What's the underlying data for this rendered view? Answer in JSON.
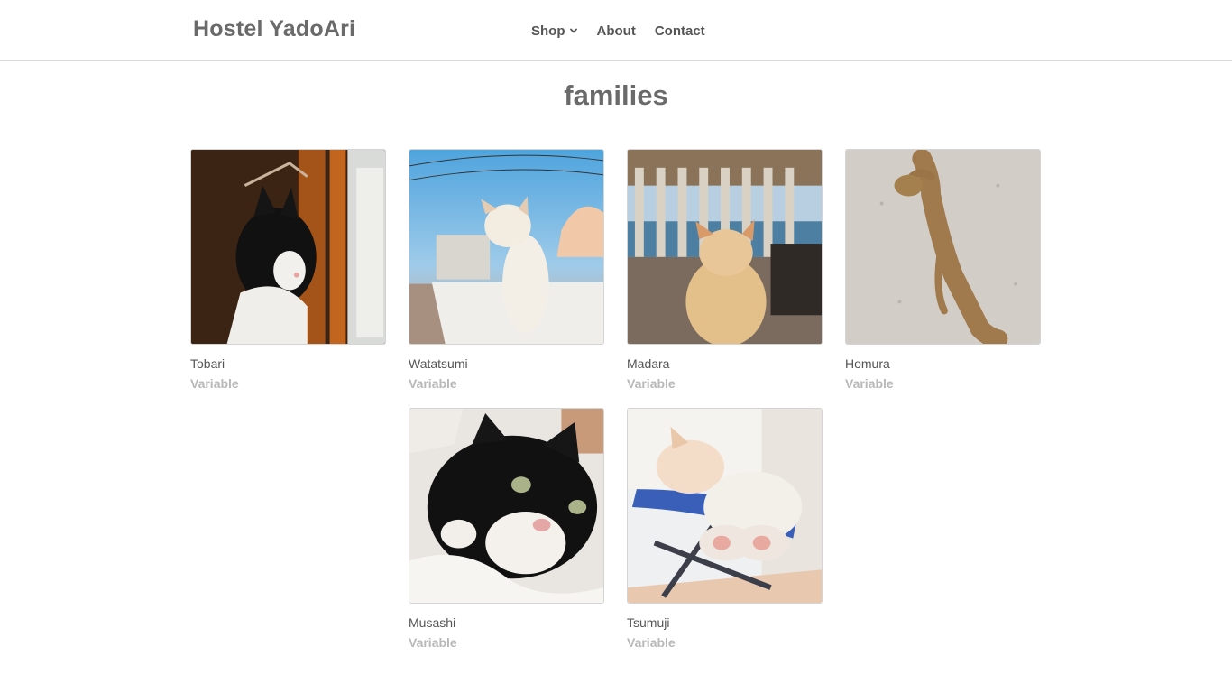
{
  "site": {
    "brand": "Hostel YadoAri"
  },
  "nav": {
    "items": [
      {
        "label": "Shop",
        "has_dropdown": true
      },
      {
        "label": "About"
      },
      {
        "label": "Contact"
      }
    ]
  },
  "page": {
    "title": "families"
  },
  "products": [
    {
      "name": "Tobari",
      "price": "Variable",
      "image": "black-and-white-cat-by-window"
    },
    {
      "name": "Watatsumi",
      "price": "Variable",
      "image": "white-cat-on-wall-sky"
    },
    {
      "name": "Madara",
      "price": "Variable",
      "image": "cream-cat-on-balcony"
    },
    {
      "name": "Homura",
      "price": "Variable",
      "image": "tabby-cat-lying-on-concrete"
    },
    {
      "name": "Musashi",
      "price": "Variable",
      "image": "black-and-white-cat-closeup"
    },
    {
      "name": "Tsumuji",
      "price": "Variable",
      "image": "sleeping-kitten-on-chair"
    }
  ],
  "colors": {
    "text": "#555555",
    "muted": "#b8b8b8",
    "border": "#d9d9d9"
  }
}
